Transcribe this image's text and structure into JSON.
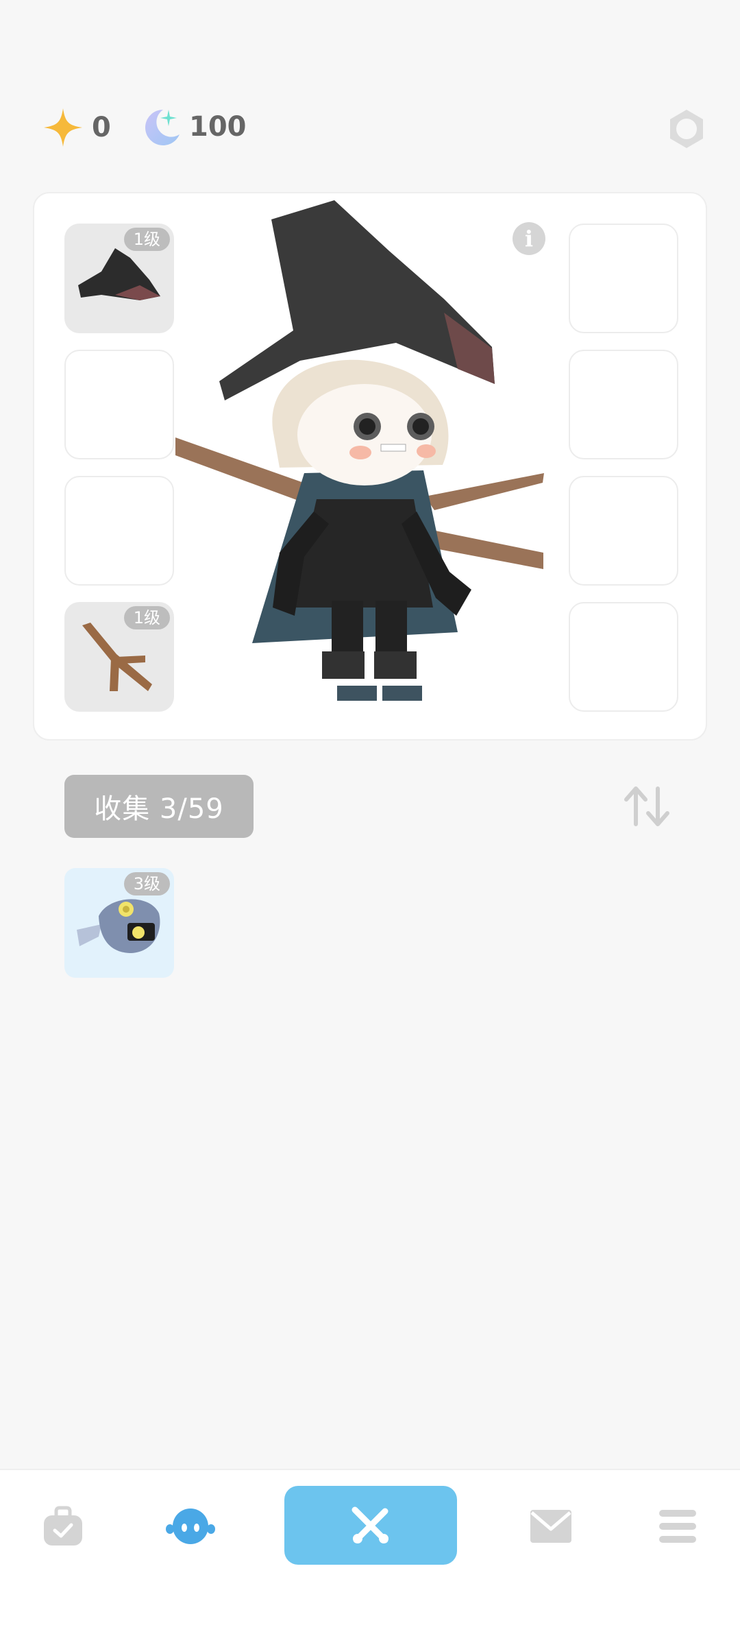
{
  "currency": {
    "star": {
      "icon": "star-icon",
      "value": "0",
      "color": "#f6b93b"
    },
    "moon": {
      "icon": "moon-icon",
      "value": "100",
      "color": "#a9b7f5"
    }
  },
  "settings_icon": "hexagon-settings-icon",
  "equipment": {
    "slots": [
      {
        "side": "left",
        "item": "witch-hat",
        "level": "1级"
      },
      {
        "side": "left",
        "item": "",
        "level": ""
      },
      {
        "side": "left",
        "item": "",
        "level": ""
      },
      {
        "side": "left",
        "item": "branch",
        "level": "1级"
      },
      {
        "side": "right",
        "item": "",
        "level": ""
      },
      {
        "side": "right",
        "item": "",
        "level": ""
      },
      {
        "side": "right",
        "item": "",
        "level": ""
      },
      {
        "side": "right",
        "item": "",
        "level": ""
      }
    ],
    "info_icon": "info-icon",
    "info_glyph": "i"
  },
  "collection": {
    "label": "收集 3/59",
    "sort_icon": "sort-icon",
    "items": [
      {
        "item": "blue-fish-creature",
        "level": "3级"
      }
    ]
  },
  "bottom_nav": {
    "items": [
      "bag-icon",
      "character-icon",
      "battle-icon",
      "mail-icon",
      "menu-icon"
    ],
    "active": "character-icon",
    "accent": "#6cc4ee"
  }
}
